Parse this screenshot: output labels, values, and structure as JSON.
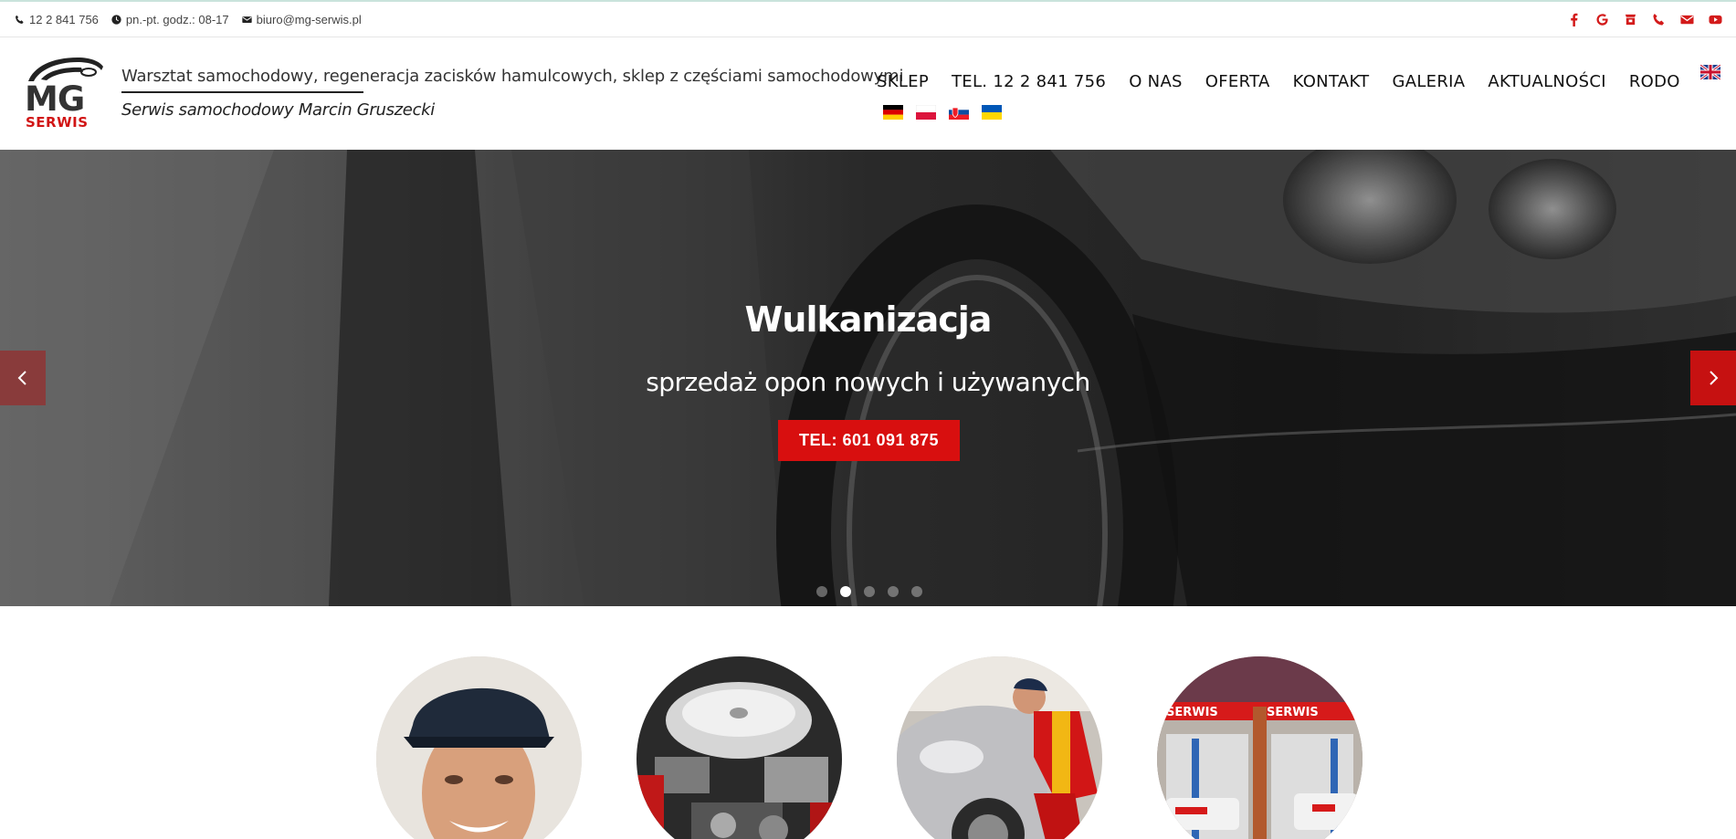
{
  "topbar": {
    "phone": "12 2 841 756",
    "hours": "pn.-pt. godz.: 08-17",
    "email": "biuro@mg-serwis.pl",
    "social_icons": [
      "facebook-icon",
      "google-icon",
      "bag-icon",
      "phone-icon",
      "mail-icon",
      "youtube-icon"
    ],
    "social_color": "#d31b1b"
  },
  "header": {
    "logo_text": "MG",
    "logo_sub": "SERWIS",
    "tagline": "Warsztat samochodowy, regeneracja zacisków hamulcowych, sklep z częściami samochodowymi",
    "subtitle": "Serwis samochodowy Marcin Gruszecki"
  },
  "nav": {
    "items": [
      {
        "label": "SKLEP"
      },
      {
        "label": "TEL. 12 2 841 756"
      },
      {
        "label": "O NAS"
      },
      {
        "label": "OFERTA"
      },
      {
        "label": "KONTAKT"
      },
      {
        "label": "GALERIA"
      },
      {
        "label": "AKTUALNOŚCI"
      },
      {
        "label": "RODO"
      }
    ],
    "languages": [
      "en",
      "de",
      "pl",
      "sk",
      "ua"
    ]
  },
  "hero": {
    "title": "Wulkanizacja",
    "subtitle": "sprzedaż opon nowych i używanych",
    "button": "TEL: 601 091 875",
    "accent": "#d80f0f",
    "slide_count": 5,
    "active_slide": 2
  },
  "features": {
    "images": [
      "mechanic-portrait",
      "engine",
      "car-repair",
      "workshop"
    ]
  }
}
